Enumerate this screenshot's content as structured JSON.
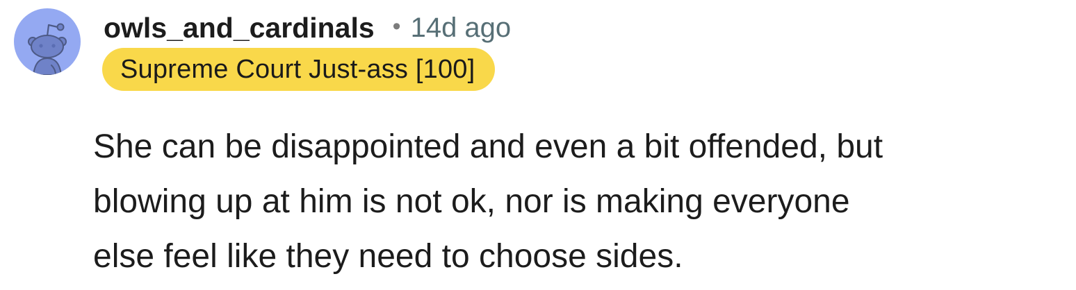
{
  "comment": {
    "author": "owls_and_cardinals",
    "separator": "•",
    "timestamp": "14d ago",
    "flair": {
      "text": "Supreme Court Just-ass [100]",
      "color": "#f9d84a"
    },
    "body_lines": [
      "She can be disappointed and even a bit offended, but",
      "blowing up at him is not ok, nor is making everyone",
      "else feel like they need to choose sides."
    ],
    "avatar": {
      "icon": "snoo-avatar-icon",
      "background_color": "#94a9f2"
    }
  }
}
